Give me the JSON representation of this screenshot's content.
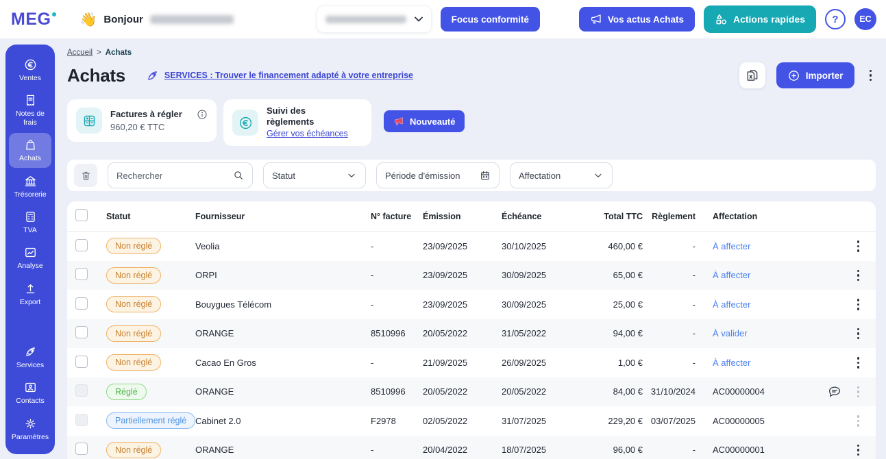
{
  "brand": {
    "logo_text": "MEG"
  },
  "topbar": {
    "wave_emoji": "👋",
    "greeting": "Bonjour",
    "focus_button": "Focus conformité",
    "actus_button": "Vos actus Achats",
    "actions_button": "Actions rapides",
    "help_label": "?",
    "avatar_initials": "EC"
  },
  "sidebar": {
    "items": [
      {
        "label": "Ventes",
        "icon": "euro-coin-icon",
        "active": false
      },
      {
        "label": "Notes de frais",
        "icon": "receipt-icon",
        "active": false
      },
      {
        "label": "Achats",
        "icon": "shopping-bag-icon",
        "active": true
      },
      {
        "label": "Trésorerie",
        "icon": "bank-icon",
        "active": false
      },
      {
        "label": "TVA",
        "icon": "calculator-icon",
        "active": false
      },
      {
        "label": "Analyse",
        "icon": "chart-icon",
        "active": false
      },
      {
        "label": "Export",
        "icon": "upload-icon",
        "active": false
      }
    ],
    "bottom_items": [
      {
        "label": "Services",
        "icon": "rocket-icon"
      },
      {
        "label": "Contacts",
        "icon": "contact-card-icon"
      },
      {
        "label": "Paramètres",
        "icon": "gear-icon"
      }
    ]
  },
  "breadcrumb": {
    "home": "Accueil",
    "separator": ">",
    "current": "Achats"
  },
  "page": {
    "title": "Achats",
    "services_link": "SERVICES : Trouver le financement adapté à votre entreprise",
    "import_button": "Importer"
  },
  "cards": {
    "invoices_to_pay": {
      "title": "Factures à régler",
      "value": "960,20 € TTC"
    },
    "payments_tracking": {
      "title": "Suivi des règlements",
      "link": "Gérer vos échéances"
    },
    "novelty_button": "Nouveauté"
  },
  "filters": {
    "search_placeholder": "Rechercher",
    "status_label": "Statut",
    "period_label": "Période d'émission",
    "affectation_label": "Affectation"
  },
  "table": {
    "headers": [
      "Statut",
      "Fournisseur",
      "N° facture",
      "Émission",
      "Échéance",
      "Total TTC",
      "Règlement",
      "Affectation"
    ],
    "rows": [
      {
        "status": "Non réglé",
        "status_type": "warning",
        "fournisseur": "Veolia",
        "facture": "-",
        "emission": "23/09/2025",
        "echeance": "30/10/2025",
        "total": "460,00 €",
        "reglement": "-",
        "affectation": "À affecter",
        "affectation_link": true,
        "comment": false,
        "disabled": false
      },
      {
        "status": "Non réglé",
        "status_type": "warning",
        "fournisseur": "ORPI",
        "facture": "-",
        "emission": "23/09/2025",
        "echeance": "30/09/2025",
        "total": "65,00 €",
        "reglement": "-",
        "affectation": "À affecter",
        "affectation_link": true,
        "comment": false,
        "disabled": false
      },
      {
        "status": "Non réglé",
        "status_type": "warning",
        "fournisseur": "Bouygues Télécom",
        "facture": "-",
        "emission": "23/09/2025",
        "echeance": "30/09/2025",
        "total": "25,00 €",
        "reglement": "-",
        "affectation": "À affecter",
        "affectation_link": true,
        "comment": false,
        "disabled": false
      },
      {
        "status": "Non réglé",
        "status_type": "warning",
        "fournisseur": "ORANGE",
        "facture": "8510996",
        "emission": "20/05/2022",
        "echeance": "31/05/2022",
        "total": "94,00 €",
        "reglement": "-",
        "affectation": "À valider",
        "affectation_link": true,
        "comment": false,
        "disabled": false
      },
      {
        "status": "Non réglé",
        "status_type": "warning",
        "fournisseur": "Cacao En Gros",
        "facture": "-",
        "emission": "21/09/2025",
        "echeance": "26/09/2025",
        "total": "1,00 €",
        "reglement": "-",
        "affectation": "À affecter",
        "affectation_link": true,
        "comment": false,
        "disabled": false
      },
      {
        "status": "Réglé",
        "status_type": "success",
        "fournisseur": "ORANGE",
        "facture": "8510996",
        "emission": "20/05/2022",
        "echeance": "20/05/2022",
        "total": "84,00 €",
        "reglement": "31/10/2024",
        "affectation": "AC00000004",
        "affectation_link": false,
        "comment": true,
        "disabled": true
      },
      {
        "status": "Partiellement réglé",
        "status_type": "info",
        "fournisseur": "Cabinet 2.0",
        "facture": "F2978",
        "emission": "02/05/2022",
        "echeance": "31/07/2025",
        "total": "229,20 €",
        "reglement": "03/07/2025",
        "affectation": "AC00000005",
        "affectation_link": false,
        "comment": false,
        "disabled": true
      },
      {
        "status": "Non réglé",
        "status_type": "warning",
        "fournisseur": "ORANGE",
        "facture": "-",
        "emission": "20/04/2022",
        "echeance": "18/07/2025",
        "total": "96,00 €",
        "reglement": "-",
        "affectation": "AC00000001",
        "affectation_link": false,
        "comment": false,
        "disabled": false
      }
    ]
  },
  "colors": {
    "primary": "#4353E6",
    "sidebar": "#3D4BD8",
    "teal": "#16A8B3",
    "link_blue": "#4B80EE",
    "badge_warning": "#C8812F",
    "badge_success": "#4DB748",
    "badge_info": "#4A90E2"
  }
}
